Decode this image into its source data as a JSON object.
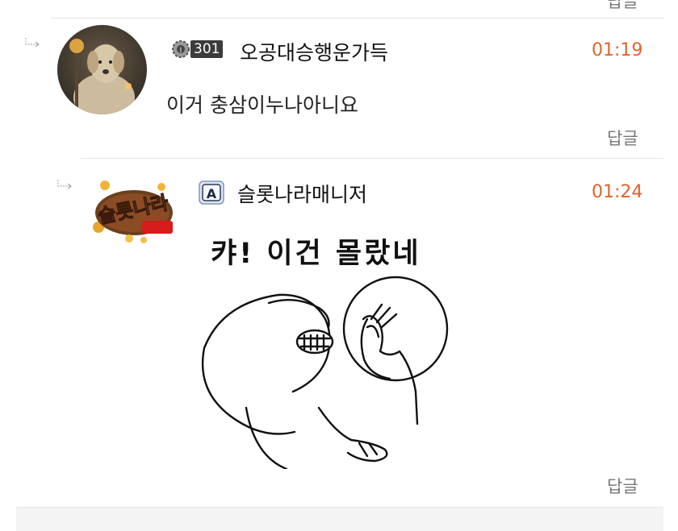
{
  "top_reply_label_partial": "답글",
  "comments": [
    {
      "level": "301",
      "nickname": "오공대승행운가득",
      "time": "01:19",
      "text": "이거 충삼이누나아니요",
      "reply_label": "답글"
    },
    {
      "badge_letter": "A",
      "nickname": "슬롯나라매니저",
      "time": "01:24",
      "sticker_caption": "캬! 이건 몰랐네",
      "reply_label": "답글"
    }
  ],
  "avatar2_text": "슬롯나라",
  "colors": {
    "time": "#e0642c",
    "divider": "#e6e6e6",
    "footer": "#f4f4f5"
  }
}
